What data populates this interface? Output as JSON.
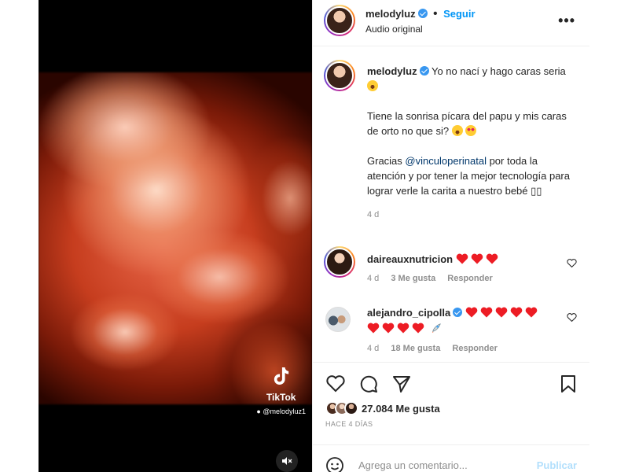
{
  "header": {
    "username": "melodyluz",
    "follow_label": "Seguir",
    "audio": "Audio original",
    "more_icon": "more-horizontal-icon"
  },
  "caption": {
    "username": "melodyluz",
    "line1": "Yo no nací y hago caras seria",
    "para2": "Tiene la sonrisa pícara del papu y mis caras de orto no que si?",
    "para3_pre": "Gracias",
    "mention": "@vinculoperinatal",
    "para3_post": "por toda la atención y por tener la mejor tecnología para lograr verle la carita a nuestro bebé",
    "para3_tail": "▯▯",
    "time": "4 d"
  },
  "comments": [
    {
      "username": "daireauxnutricion",
      "time": "4 d",
      "likes": "3 Me gusta",
      "reply": "Responder",
      "hearts": 3
    },
    {
      "username": "alejandro_cipolla",
      "time": "4 d",
      "likes": "18 Me gusta",
      "reply": "Responder",
      "hearts_line1": 5,
      "hearts_line2": 4
    }
  ],
  "actions": {
    "likes": "27.084 Me gusta",
    "date": "HACE 4 DÍAS"
  },
  "comment_box": {
    "placeholder": "Agrega un comentario...",
    "publish": "Publicar"
  },
  "media": {
    "tiktok_brand": "TikTok",
    "tiktok_handle": "@melodyluz1"
  },
  "colors": {
    "accent": "#0095f6",
    "verified": "#3897f0",
    "heart": "#ed1c24",
    "mention": "#00376b",
    "secondary_text": "#8e8e8e"
  }
}
